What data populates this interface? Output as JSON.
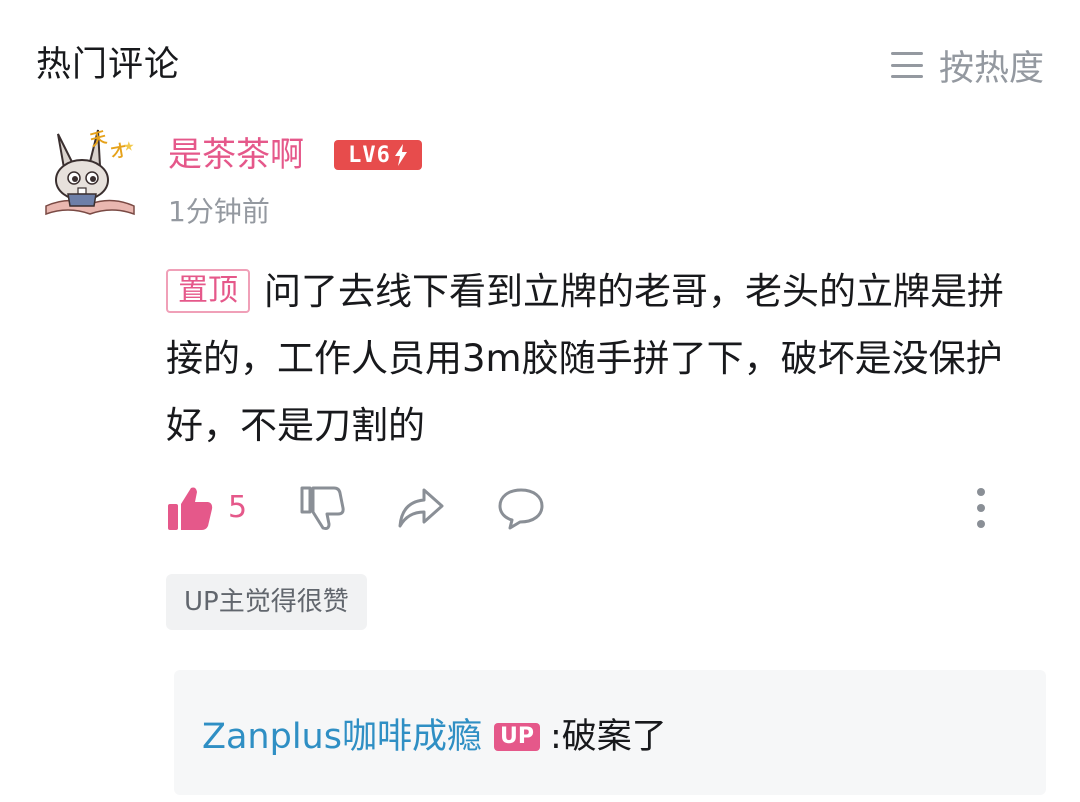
{
  "header": {
    "title": "热门评论",
    "sort_label": "按热度"
  },
  "comment": {
    "username": "是茶茶啊",
    "level": "LV6",
    "time": "1分钟前",
    "pin_label": "置顶",
    "text": "问了去线下看到立牌的老哥，老头的立牌是拼接的，工作人员用3m胶随手拼了下，破坏是没保护好，不是刀割的",
    "like_count": "5",
    "up_liked_label": "UP主觉得很赞"
  },
  "reply": {
    "username": "Zanplus咖啡成瘾",
    "badge": "UP",
    "separator": ":",
    "text": "破案了"
  },
  "colors": {
    "accent_pink": "#e5588a",
    "reply_user_blue": "#2f8fc4",
    "level_red": "#e74c4c",
    "muted": "#9499a0"
  },
  "icons": [
    "sort-icon",
    "avatar",
    "like-icon",
    "dislike-icon",
    "share-icon",
    "reply-icon",
    "more-icon"
  ]
}
